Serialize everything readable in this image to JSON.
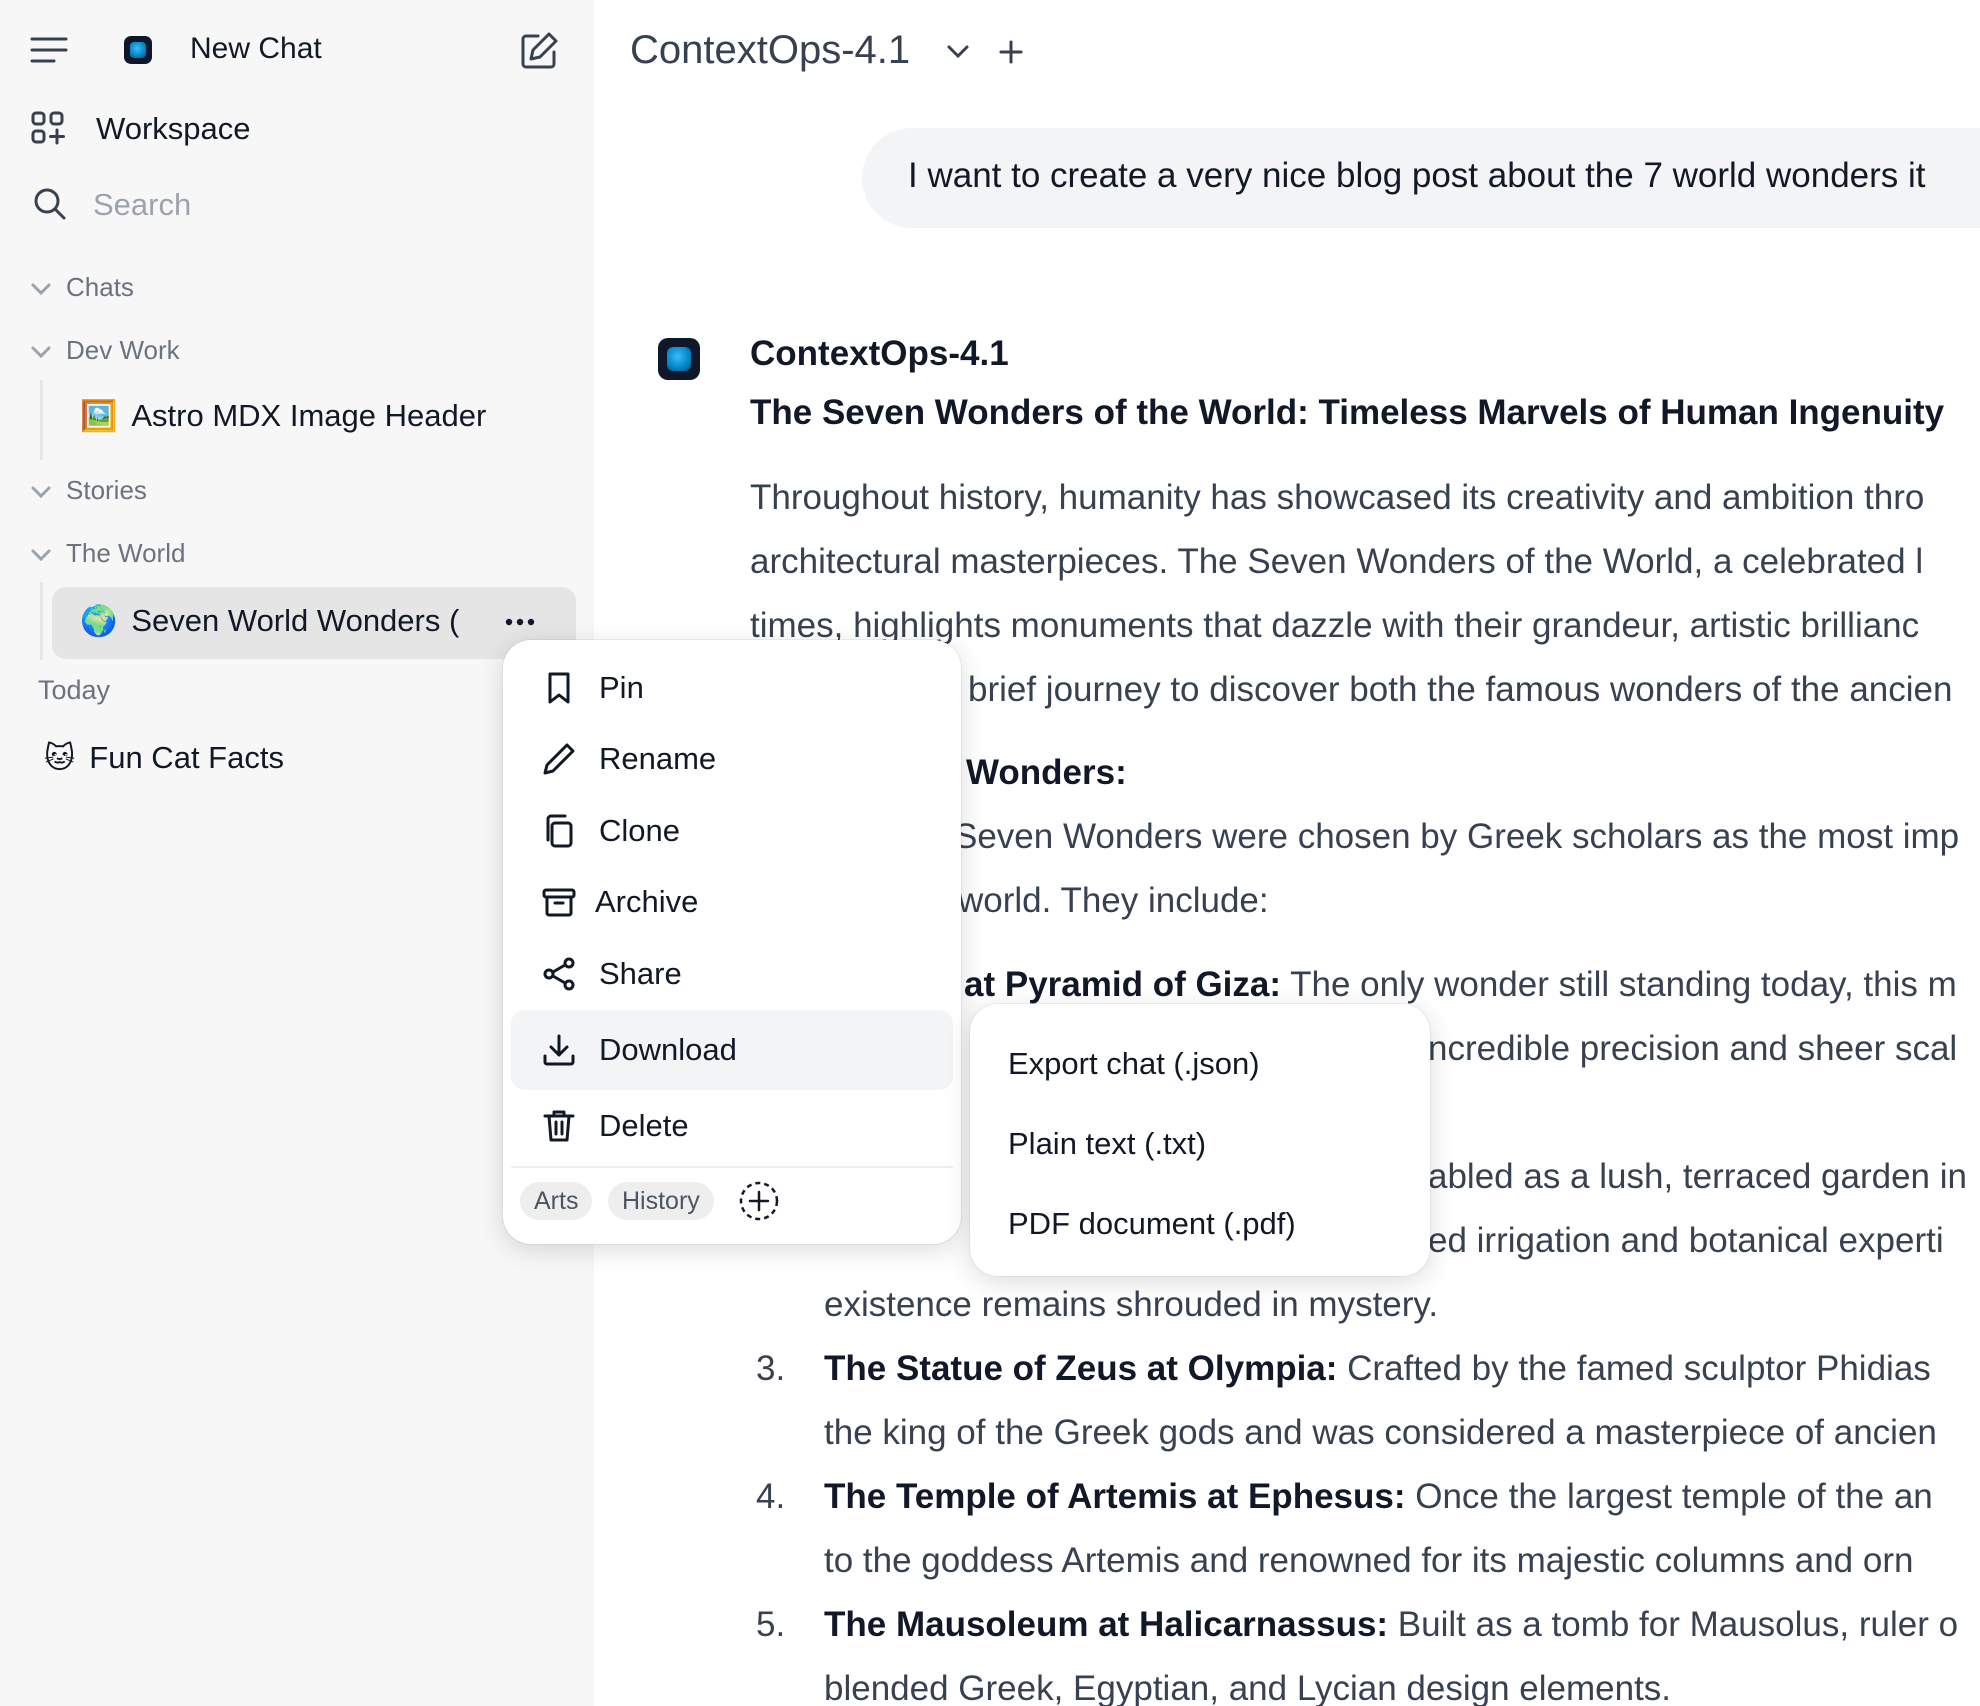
{
  "sidebar": {
    "new_chat": "New Chat",
    "workspace": "Workspace",
    "search_placeholder": "Search",
    "folders": [
      {
        "name": "Chats"
      },
      {
        "name": "Dev Work",
        "items": [
          {
            "emoji": "🖼️",
            "title": "Astro MDX Image Header"
          }
        ]
      },
      {
        "name": "Stories"
      },
      {
        "name": "The World",
        "items": [
          {
            "emoji": "🌍",
            "title": "Seven World Wonders ("
          }
        ]
      }
    ],
    "today_label": "Today",
    "today_items": [
      {
        "emoji": "🐱",
        "title": "Fun Cat Facts"
      }
    ]
  },
  "header": {
    "model_name": "ContextOps-4.1"
  },
  "conversation": {
    "user_message": "I want to create a very nice blog post about the 7 world wonders it",
    "assistant_name": "ContextOps-4.1",
    "heading": "The Seven Wonders of the World: Timeless Marvels of Human Ingenuity",
    "intro_lines": [
      "Throughout history, humanity has showcased its creativity and ambition thro",
      "architectural masterpieces. The Seven Wonders of the World, a celebrated l",
      "times, highlights monuments that dazzle with their grandeur, artistic brillianc",
      "brief journey to discover both the famous wonders of the ancien"
    ],
    "ancient_heading": "Wonders:",
    "ancient_lines": [
      "Seven Wonders were chosen by Greek scholars as the most imp",
      "world. They include:"
    ],
    "list": [
      {
        "title_fragment": "at Pyramid of Giza:",
        "text": " The only wonder still standing today, this m"
      },
      {
        "cont": "ncredible precision and sheer scal"
      },
      {
        "frag": "abled as a lush, terraced garden in"
      },
      {
        "frag2": "ed irrigation and botanical experti"
      },
      {
        "cont": "existence remains shrouded in mystery."
      },
      {
        "num": "3.",
        "title": "The Statue of Zeus at Olympia:",
        "text": " Crafted by the famed sculptor Phidias",
        "cont": "the king of the Greek gods and was considered a masterpiece of ancien"
      },
      {
        "num": "4.",
        "title": "The Temple of Artemis at Ephesus:",
        "text": " Once the largest temple of the an",
        "cont": "to the goddess Artemis and renowned for its majestic columns and orn"
      },
      {
        "num": "5.",
        "title": "The Mausoleum at Halicarnassus:",
        "text": " Built as a tomb for Mausolus, ruler o",
        "cont": "blended Greek, Egyptian, and Lycian design elements."
      }
    ]
  },
  "context_menu": {
    "items": [
      {
        "label": "Pin",
        "icon": "bookmark-icon"
      },
      {
        "label": "Rename",
        "icon": "pencil-icon"
      },
      {
        "label": "Clone",
        "icon": "copy-icon"
      },
      {
        "label": "Archive",
        "icon": "archive-icon"
      },
      {
        "label": "Share",
        "icon": "share-icon"
      },
      {
        "label": "Download",
        "icon": "download-icon"
      },
      {
        "label": "Delete",
        "icon": "trash-icon"
      }
    ],
    "tags": [
      "Arts",
      "History"
    ]
  },
  "download_submenu": {
    "items": [
      "Export chat (.json)",
      "Plain text (.txt)",
      "PDF document (.pdf)"
    ]
  }
}
